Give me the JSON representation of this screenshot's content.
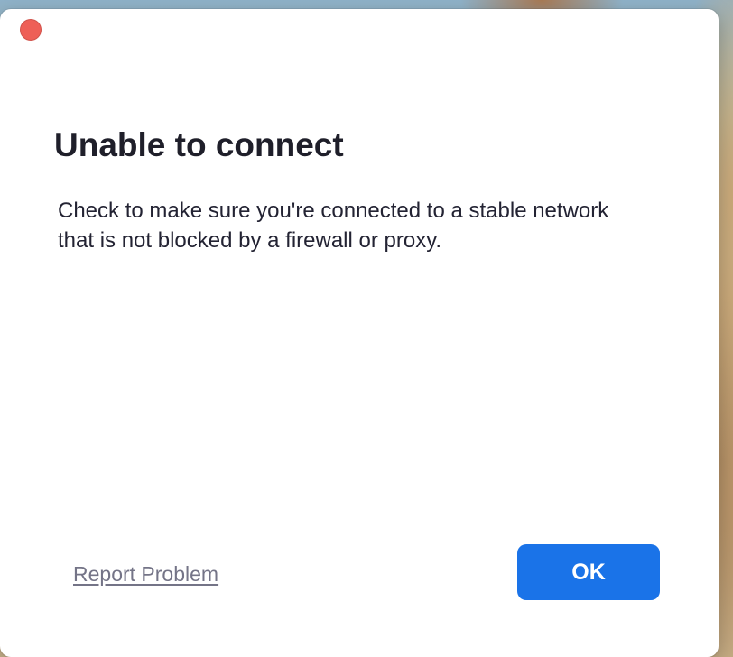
{
  "dialog": {
    "title": "Unable to connect",
    "message": "Check to make sure you're connected to a stable network that is not blocked by a firewall or proxy.",
    "report_link_label": "Report Problem",
    "ok_label": "OK"
  },
  "window_controls": {
    "close_icon": "close-dot-icon"
  },
  "colors": {
    "accent": "#1a73e8",
    "close_dot": "#ee5f57",
    "title_text": "#1f1f2a",
    "link_text": "#747487"
  }
}
